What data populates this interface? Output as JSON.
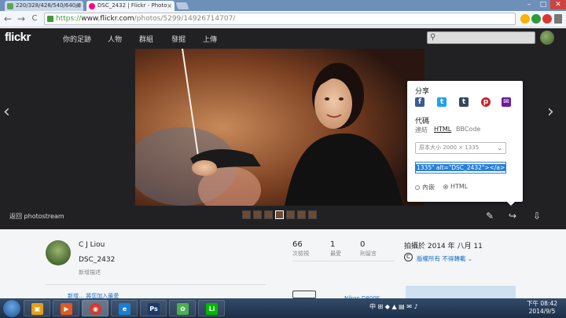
{
  "browser": {
    "tabs": [
      {
        "label": "220/328/428/540/640/8"
      },
      {
        "label": "DSC_2432 | Flickr - Photo"
      }
    ],
    "tab_close": "×",
    "url": {
      "scheme": "https://",
      "host": "www.flickr.com",
      "path": "/photos/5299/14926714707/"
    },
    "back": "←",
    "forward": "→",
    "reload": "C",
    "window_controls": {
      "min": "–",
      "max": "□",
      "close": "✕"
    }
  },
  "header": {
    "logo": "flickr",
    "nav": [
      "你的足跡",
      "人物",
      "群組",
      "發掘",
      "上傳"
    ],
    "search_icon": "⚲"
  },
  "photo": {
    "back_label": "返回 photostream",
    "prev_arrow": "‹",
    "next_arrow": "›",
    "actions": {
      "edit": "✎",
      "share": "↪",
      "download": "⇩"
    }
  },
  "share_panel": {
    "title": "分享",
    "icons": [
      {
        "name": "facebook",
        "glyph": "f",
        "color": "#3b5998"
      },
      {
        "name": "twitter",
        "glyph": "t",
        "color": "#1da1f2"
      },
      {
        "name": "tumblr",
        "glyph": "t",
        "color": "#35465c"
      },
      {
        "name": "pinterest",
        "glyph": "p",
        "color": "#cb2027"
      },
      {
        "name": "email",
        "glyph": "✉",
        "color": "#6a1b9a"
      }
    ],
    "code_label": "代碼",
    "code_tabs": [
      "連結",
      "HTML",
      "BBCode"
    ],
    "size_select": "原本大小 2000 × 1335",
    "code_value": "1335\" alt=\"DSC_2432\"></a>",
    "embed_options": [
      {
        "label": "內嵌",
        "selected": false
      },
      {
        "label": "HTML",
        "selected": true
      }
    ]
  },
  "info": {
    "owner": "C J Liou",
    "title": "DSC_2432",
    "add_description": "新增描述",
    "stats": [
      {
        "value": "66",
        "label": "次檢視"
      },
      {
        "value": "1",
        "label": "最愛"
      },
      {
        "value": "0",
        "label": "則留言"
      }
    ],
    "taken_on": "拍攝於 2014 年 八月 11",
    "license_icon": "C",
    "license": "版權所有 不得轉載 ⌄",
    "people": "新增…  將您加入最愛",
    "camera": "Nikon D800E"
  },
  "taskbar": {
    "apps": [
      {
        "name": "explorer",
        "glyph": "▣",
        "color": "#e0a020"
      },
      {
        "name": "media",
        "glyph": "▶",
        "color": "#e05a20"
      },
      {
        "name": "chrome",
        "glyph": "◉",
        "color": "#d33b2c"
      },
      {
        "name": "ie",
        "glyph": "e",
        "color": "#1a7fd4"
      },
      {
        "name": "photoshop",
        "glyph": "Ps",
        "color": "#1b3a6b"
      },
      {
        "name": "picasa",
        "glyph": "✿",
        "color": "#4caf50"
      },
      {
        "name": "line",
        "glyph": "Li",
        "color": "#00b900"
      }
    ],
    "tray": "中 ⊞ ◆ ▲ ▤ ✉ ♪",
    "time": "下午 08:42",
    "date": "2014/9/5"
  }
}
